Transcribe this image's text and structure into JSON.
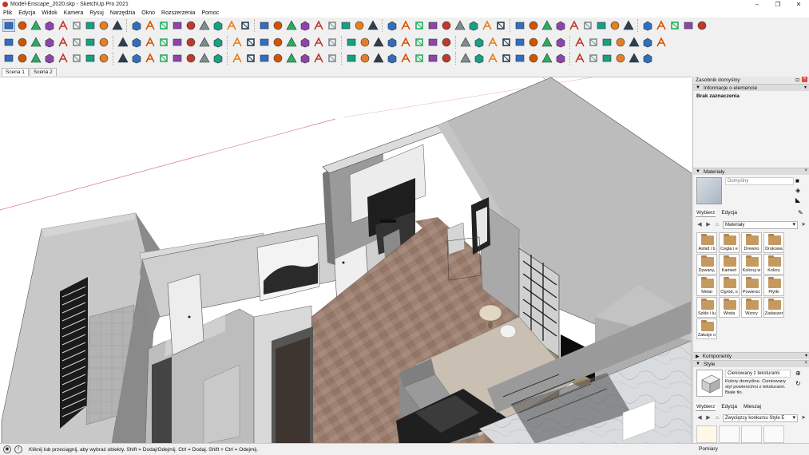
{
  "window": {
    "title": "Model-Enscape_2020.skp - SketchUp Pro 2021",
    "controls": [
      "–",
      "❐",
      "✕"
    ]
  },
  "menu": {
    "items": [
      "Plik",
      "Edycja",
      "Widok",
      "Kamera",
      "Rysuj",
      "Narzędzia",
      "Okno",
      "Rozszerzenia",
      "Pomoc"
    ]
  },
  "toolbars": {
    "row1_icons": [
      "select-icon",
      "eraser-icon",
      "line-icon",
      "line-dropdown-icon",
      "arc-icon",
      "arc-dropdown-icon",
      "shape-icon",
      "shape-dropdown-icon",
      "push-pull-icon",
      "move-icon",
      "rotate-icon",
      "scale-icon",
      "offset-icon",
      "tape-measure-icon",
      "text-icon",
      "paint-bucket-icon",
      "orbit-icon",
      "pan-icon",
      "zoom-icon",
      "zoom-extents-icon",
      "warehouse-icon",
      "extension-warehouse-icon",
      "layout-icon",
      "account-icon",
      "section-plane-icon",
      "axes-icon",
      "dimension-icon",
      "protractor-icon",
      "3d-text-icon",
      "walk-icon",
      "look-around-icon",
      "solid-union-icon",
      "solid-subtract-icon",
      "outer-shell-icon",
      "trim-icon",
      "split-icon",
      "intersect-icon",
      "xray-icon",
      "back-edges-icon",
      "wireframe-icon",
      "hidden-line-icon",
      "shaded-icon",
      "textured-icon",
      "monochrome-icon",
      "iso-view-icon",
      "top-view-icon",
      "front-view-icon",
      "right-view-icon",
      "back-view-icon",
      "left-view-icon"
    ],
    "row2_icons": [
      "select-alt-icon",
      "make-component-icon",
      "make-group-icon",
      "align-left-icon",
      "align-center-icon",
      "align-right-icon",
      "dash-icon",
      "dash-dot-icon",
      "dash-long-icon",
      "grid-icon",
      "grid-2-icon",
      "grid-3-icon",
      "profile-icon",
      "sandbox-icon",
      "smoove-icon",
      "stamp-icon",
      "drape-icon",
      "add-detail-icon",
      "flip-edge-icon",
      "column-icon",
      "table-icon",
      "line-style-icon",
      "line-style-2-icon",
      "line-style-3-icon",
      "pen-icon",
      "eraser-2-icon",
      "red-arrow-icon",
      "red-arrow-2-icon",
      "red-arrow-3-icon",
      "green-arrow-icon",
      "green-arrow-2-icon",
      "green-arrow-3-icon",
      "pink-arrow-icon",
      "pink-arrow-2-icon",
      "sphere-icon",
      "green-sphere-icon",
      "red-sphere-icon",
      "material-icon",
      "material-2-icon",
      "blank-icon",
      "bottle-icon",
      "info-icon",
      "magic-icon",
      "cursor-icon",
      "move-cross-icon",
      "refresh-icon",
      "expand-icon"
    ],
    "row3_icons": [
      "house-orange-icon",
      "house-green-icon",
      "house-blue-icon",
      "house-purple-icon",
      "house-red-icon",
      "flask-icon",
      "cube-outline-icon",
      "cube-outline-2-icon",
      "cube-outline-3-icon",
      "cylinder-icon",
      "wand-icon",
      "gem-icon",
      "hammer-icon",
      "hammer-2-icon",
      "hammer-3-icon",
      "hammer-4-icon",
      "hammer-5-icon",
      "hammer-6-icon",
      "light-bulb-icon",
      "tools-icon",
      "play-icon",
      "stop-icon",
      "prev-icon",
      "hand-icon",
      "pin-icon",
      "crosshair-icon",
      "cube-blue-icon",
      "cube-blue-2-icon",
      "cube-blue-3-icon",
      "gear-orange-icon",
      "window-icon",
      "box-3d-icon",
      "box-3d-2-icon",
      "box-3d-3-icon",
      "rgb-cube-icon",
      "tools-2-icon",
      "brush-icon",
      "paint-icon",
      "leaf-icon",
      "enscape-logo-icon",
      "cube-gold-icon",
      "cube-gold-2-icon",
      "cube-gold-3-icon",
      "frame-icon",
      "frame-2-icon",
      "frame-3-icon"
    ]
  },
  "scenes": {
    "tabs": [
      {
        "label": "Scena 1",
        "active": true
      },
      {
        "label": "Scena 2",
        "active": false
      }
    ]
  },
  "tray": {
    "title": "Zasobnik domyślny",
    "entity_info": {
      "header": "Informacje o elemencie",
      "value": "Brak zaznaczenia"
    },
    "materials": {
      "header": "Materiały",
      "current_name": "Domyślny",
      "tab_select": "Wybierz",
      "tab_edit": "Edycja",
      "library": "Materiały",
      "folders": [
        "Asfalt i b",
        "Cegła i e",
        "Drewno",
        "Drukowa",
        "Dywany,",
        "Kamień",
        "Koloruj w",
        "Kolory",
        "Metal",
        "Ogród, o",
        "Powierzc",
        "Płytki",
        "Szkło i lu",
        "Woda",
        "Wzory",
        "Zadaszer",
        "Załużje o"
      ]
    },
    "components": {
      "header": "Komponenty"
    },
    "styles": {
      "header": "Style",
      "current_name": "Cieniowany z teksturami",
      "description": "Kolory domyślne. Cieniowany styl powierzchni z teksturami. Białe tło.",
      "tab_select": "Wybierz",
      "tab_edit": "Edycja",
      "tab_mix": "Mieszaj",
      "library": "Zwycięzcy konkursu Style E"
    },
    "shadows": {
      "header": "Pomiary"
    }
  },
  "status": {
    "text": "Kliknij lub przeciągnij, aby wybrać obiekty. Shift = Dodaj/Odejmij. Ctrl = Dodaj. Shift + Ctrl = Odejmij."
  },
  "colors": {
    "floor": "#9c8070",
    "wall_top": "#d6d6d6",
    "wall_side": "#8f8f8f",
    "accent_blue": "#2f6fbf"
  }
}
